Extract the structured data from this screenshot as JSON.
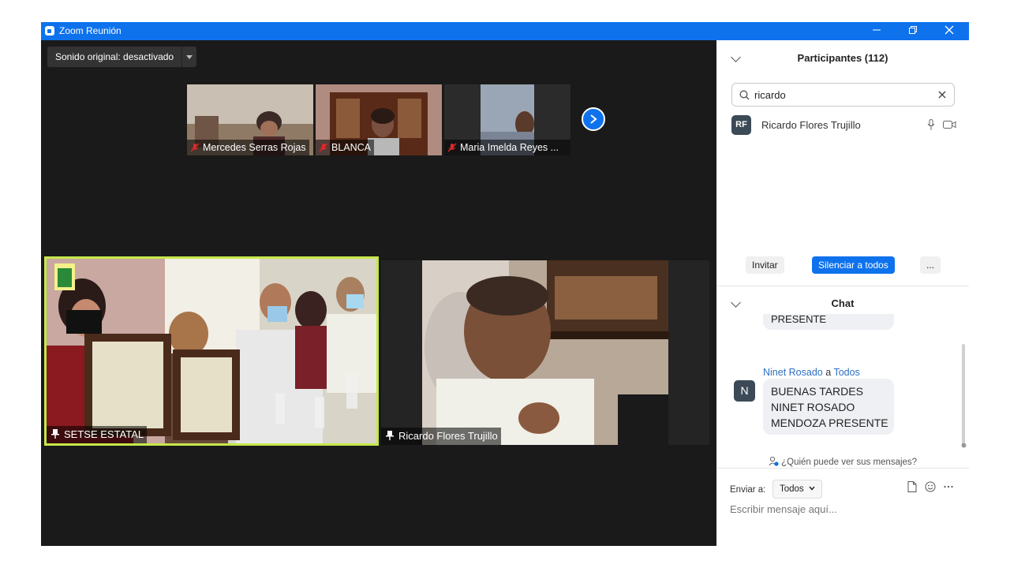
{
  "window": {
    "title": "Zoom Reunión",
    "minimize": "—",
    "restore": "⧉",
    "close": "✕"
  },
  "stage": {
    "audio_button": "Sonido original: desactivado",
    "thumbnails": [
      {
        "name": "Mercedes Serras Rojas",
        "muted": true
      },
      {
        "name": "BLANCA",
        "muted": true
      },
      {
        "name": "Maria Imelda Reyes ...",
        "muted": true
      }
    ],
    "next_arrow": "›",
    "main_videos": [
      {
        "name": "SETSE ESTATAL",
        "pinned": true,
        "active_speaker": true
      },
      {
        "name": "Ricardo Flores Trujillo",
        "pinned": true,
        "active_speaker": false
      }
    ]
  },
  "participants": {
    "header": "Participantes (112)",
    "search_value": "ricardo",
    "list": [
      {
        "initials": "RF",
        "name": "Ricardo Flores Trujillo"
      }
    ],
    "invite": "Invitar",
    "mute_all": "Silenciar a todos",
    "more": "..."
  },
  "chat": {
    "header": "Chat",
    "partial_message": "PRESENTE",
    "message": {
      "sender": "Ninet Rosado",
      "connector": "a",
      "recipient": "Todos",
      "avatar": "N",
      "lines": [
        "BUENAS TARDES",
        "NINET ROSADO",
        "MENDOZA PRESENTE"
      ]
    },
    "who_can_see": "¿Quién puede ver sus mensajes?",
    "send_to_label": "Enviar a:",
    "send_to_value": "Todos",
    "input_placeholder": "Escribir mensaje aquí..."
  },
  "colors": {
    "accent": "#0e72ed",
    "active_speaker_border": "#c5e84a",
    "stage_bg": "#1a1a1a"
  }
}
